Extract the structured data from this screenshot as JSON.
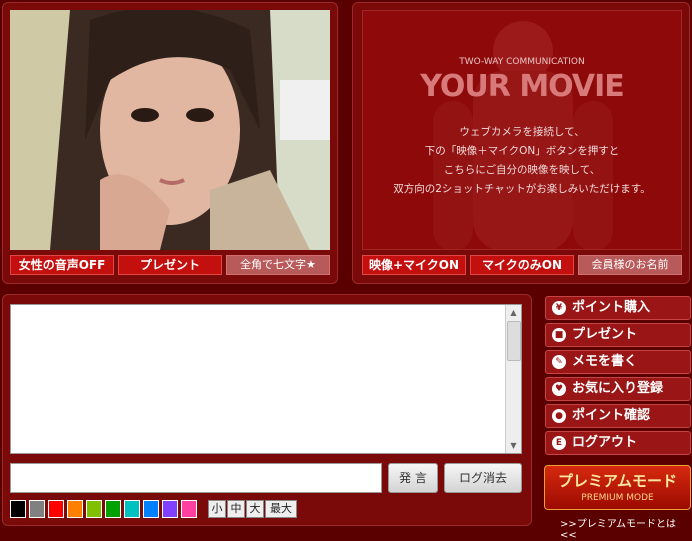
{
  "left": {
    "voice_toggle": "女性の音声OFF",
    "present_button": "プレゼント",
    "char_limit": "全角で七文字★"
  },
  "movie": {
    "subtitle": "TWO-WAY COMMUNICATION",
    "title": "YOUR MOVIE",
    "desc": [
      "ウェブカメラを接続して、",
      "下の「映像＋マイクON」ボタンを押すと",
      "こちらにご自分の映像を映して、",
      "双方向の2ショットチャットがお楽しみいただけます。"
    ],
    "video_mic_on": "映像+マイクON",
    "mic_only_on": "マイクのみON",
    "member_name": "会員様のお名前"
  },
  "chat": {
    "send_button": "発 言",
    "clear_log_button": "ログ消去",
    "colors": [
      "#000000",
      "#808080",
      "#ff0000",
      "#ff8000",
      "#80c000",
      "#00a000",
      "#00c0c0",
      "#0080ff",
      "#8040ff",
      "#ff40a0"
    ],
    "sizes": [
      "小",
      "中",
      "大",
      "最大"
    ]
  },
  "menu": [
    {
      "label": "ポイント購入",
      "icon": "yen-icon"
    },
    {
      "label": "プレゼント",
      "icon": "gift-icon"
    },
    {
      "label": "メモを書く",
      "icon": "pencil-icon"
    },
    {
      "label": "お気に入り登録",
      "icon": "heart-icon"
    },
    {
      "label": "ポイント確認",
      "icon": "search-icon"
    },
    {
      "label": "ログアウト",
      "icon": "logout-icon"
    }
  ],
  "premium": {
    "title": "プレミアムモード",
    "subtitle": "PREMIUM MODE",
    "link": ">>プレミアムモードとは <<"
  }
}
